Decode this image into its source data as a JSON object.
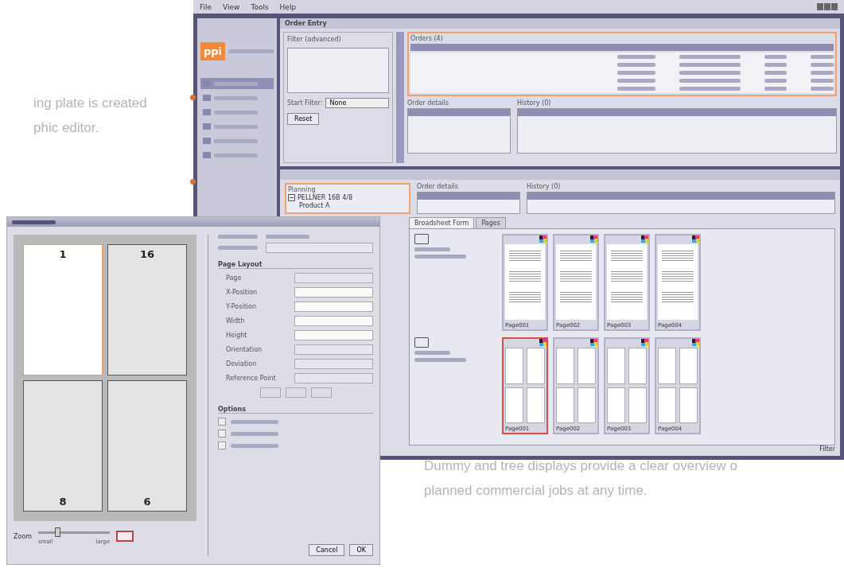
{
  "captions": [
    {
      "lines": [
        "ing plate is created",
        "phic editor."
      ]
    },
    {
      "lines": [
        "Dummy and tree displays provide a clear overview o",
        "planned commercial jobs at any time."
      ]
    }
  ],
  "main_window": {
    "menu": [
      "File",
      "View",
      "Tools",
      "Help"
    ],
    "sidebar": {
      "logo": "ppi",
      "items": [
        {
          "selected": true
        },
        {
          "selected": false
        },
        {
          "selected": false
        },
        {
          "selected": false
        },
        {
          "selected": false
        },
        {
          "selected": false
        }
      ]
    },
    "order_entry": {
      "title": "Order Entry",
      "filter_title": "Filter (advanced)",
      "start_filter_label": "Start Filter:",
      "start_filter_value": "None",
      "reset": "Reset",
      "orders_title": "Orders (4)",
      "details_title": "Order details",
      "history_title": "History (0)"
    },
    "planning": {
      "title": "Planning",
      "tree": [
        {
          "label": "PELLNER 16B 4/8",
          "expanded": true,
          "children": [
            {
              "label": "Product A"
            }
          ]
        }
      ],
      "details_title": "Order details",
      "history_title": "History (0)",
      "tabs": [
        {
          "label": "Broadsheet Form",
          "selected": true
        },
        {
          "label": "Pages",
          "selected": false
        }
      ],
      "forms": [
        {
          "kind": "single",
          "pages": [
            {
              "label": "Page001",
              "selected": false
            },
            {
              "label": "Page002",
              "selected": false
            },
            {
              "label": "Page003",
              "selected": false
            },
            {
              "label": "Page004",
              "selected": false
            }
          ]
        },
        {
          "kind": "quad",
          "pages": [
            {
              "label": "Page001",
              "selected": true
            },
            {
              "label": "Page002",
              "selected": false
            },
            {
              "label": "Page003",
              "selected": false
            },
            {
              "label": "Page004",
              "selected": false
            }
          ]
        }
      ],
      "filter": "Filter"
    }
  },
  "dialog": {
    "sheet_pages": [
      {
        "number": "1",
        "selected": true
      },
      {
        "number": "16",
        "selected": false
      },
      {
        "number": "8",
        "selected": false
      },
      {
        "number": "6",
        "selected": false
      }
    ],
    "zoom_label": "Zoom",
    "zoom_small": "small",
    "zoom_large": "large",
    "zoom_slider": {
      "level": 0.25
    },
    "fields": [
      "Page",
      "X-Position",
      "Y-Position",
      "Width",
      "Height",
      "Orientation",
      "Deviation",
      "Reference Point"
    ],
    "page_layout": "Page Layout",
    "option_checks": [
      {
        "checked": false
      },
      {
        "checked": false
      },
      {
        "checked": false
      }
    ],
    "options": "Options",
    "cancel": "Cancel",
    "ok": "OK"
  }
}
